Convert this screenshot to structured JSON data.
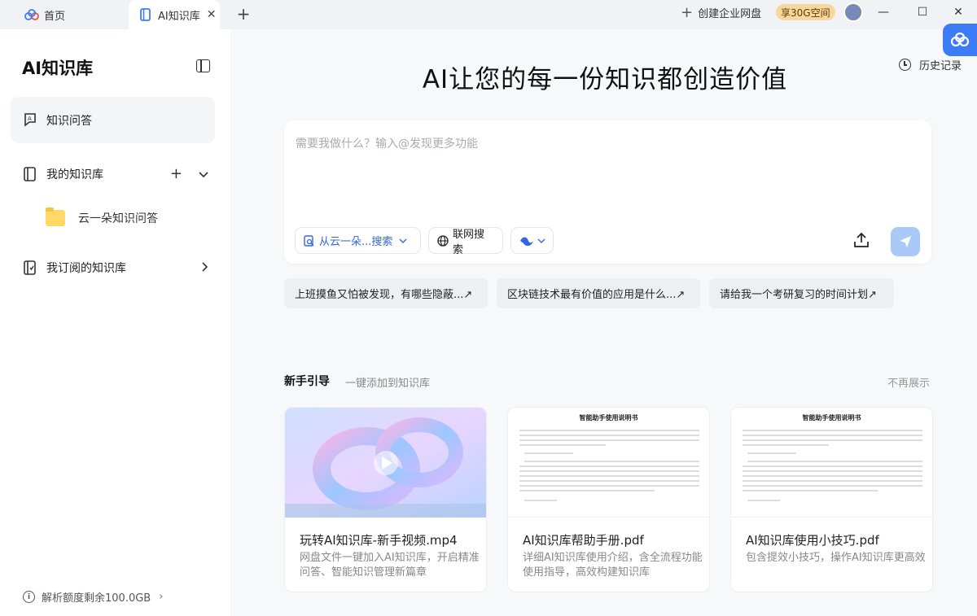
{
  "tabs": {
    "home_label": "首页",
    "active_label": "AI知识库",
    "close_glyph": "✕",
    "add_glyph": "+"
  },
  "topbar": {
    "create_enterprise": "创建企业网盘",
    "vip_badge": "享30G空间",
    "minimize_glyph": "—",
    "maximize_glyph": "☐",
    "close_glyph": "✕"
  },
  "sidebar": {
    "title": "AI知识库",
    "items": [
      {
        "label": "知识问答",
        "icon": "qa-icon"
      },
      {
        "label": "我的知识库",
        "icon": "notebook-icon"
      },
      {
        "label": "我订阅的知识库",
        "icon": "subscribe-book-icon"
      }
    ],
    "sub_items": [
      {
        "label": "云一朵知识问答",
        "icon": "folder-icon"
      }
    ],
    "footer": "解析额度剩余100.0GB"
  },
  "main": {
    "history": "历史记录",
    "hero": "AI让您的每一份知识都创造价值",
    "input_placeholder": "需要我做什么？输入@发现更多功能",
    "chips": {
      "search": "从云一朵...搜索",
      "web": "联网搜索"
    },
    "suggestions": [
      "上班摸鱼又怕被发现，有哪些隐蔽...↗",
      "区块链技术最有价值的应用是什么...↗",
      "请给我一个考研复习的时间计划↗"
    ],
    "guide": {
      "title": "新手引导",
      "subtitle": "一键添加到知识库",
      "hide": "不再展示",
      "cards": [
        {
          "title": "玩转AI知识库-新手视频.mp4",
          "desc": "网盘文件一键加入AI知识库，开启精准问答、智能知识管理新篇章",
          "thumb": "video"
        },
        {
          "title": "AI知识库帮助手册.pdf",
          "desc": "详细AI知识库使用介绍，含全流程功能使用指导，高效构建知识库",
          "thumb": "doc",
          "doc_heading": "智能助手使用说明书"
        },
        {
          "title": "AI知识库使用小技巧.pdf",
          "desc": "包含提效小技巧，操作AI知识库更高效",
          "thumb": "doc",
          "doc_heading": "智能助手使用说明书"
        }
      ]
    }
  },
  "colors": {
    "accent": "#3366e6",
    "send_disabled": "#a9c9f8",
    "vip": "#f7d79c",
    "folder": "#ffd966"
  }
}
